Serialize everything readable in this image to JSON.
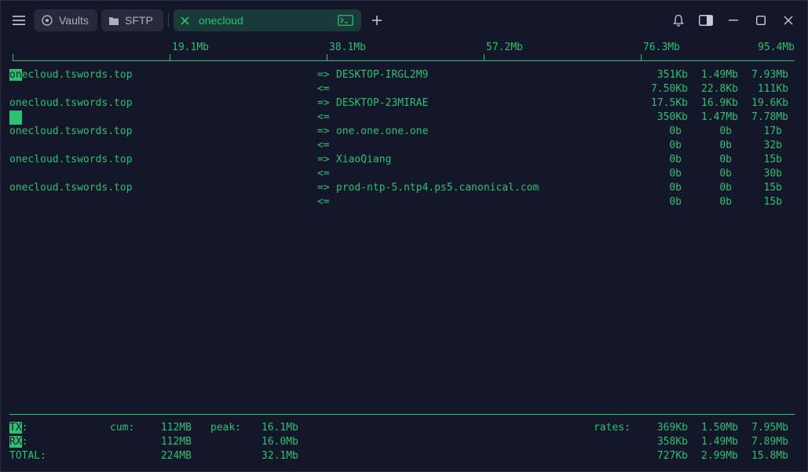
{
  "tabs": {
    "vaults": "Vaults",
    "sftp": "SFTP",
    "active": "onecloud"
  },
  "scale": [
    "19.1Mb",
    "38.1Mb",
    "57.2Mb",
    "76.3Mb",
    "95.4Mb"
  ],
  "connections": [
    {
      "host": "onecloud.tswords.top",
      "dest": "DESKTOP-IRGL2M9",
      "out": [
        "351Kb",
        "1.49Mb",
        "7.93Mb"
      ],
      "in": [
        "7.50Kb",
        "22.8Kb",
        "111Kb"
      ]
    },
    {
      "host": "onecloud.tswords.top",
      "dest": "DESKTOP-23MIRAE",
      "out": [
        "17.5Kb",
        "16.9Kb",
        "19.6Kb"
      ],
      "in": [
        "350Kb",
        "1.47Mb",
        "7.78Mb"
      ]
    },
    {
      "host": "onecloud.tswords.top",
      "dest": "one.one.one.one",
      "out": [
        "0b",
        "0b",
        "17b"
      ],
      "in": [
        "0b",
        "0b",
        "32b"
      ]
    },
    {
      "host": "onecloud.tswords.top",
      "dest": "XiaoQiang",
      "out": [
        "0b",
        "0b",
        "15b"
      ],
      "in": [
        "0b",
        "0b",
        "30b"
      ]
    },
    {
      "host": "onecloud.tswords.top",
      "dest": "prod-ntp-5.ntp4.ps5.canonical.com",
      "out": [
        "0b",
        "0b",
        "15b"
      ],
      "in": [
        "0b",
        "0b",
        "15b"
      ]
    }
  ],
  "arrows": {
    "out": "=>",
    "in": "<="
  },
  "totals": {
    "tx_label": "TX:",
    "rx_label": "RX:",
    "total_label": "TOTAL:",
    "cum_label": "cum:",
    "peak_label": "peak:",
    "rates_label": "rates:",
    "tx_cum": "112MB",
    "rx_cum": "112MB",
    "total_cum": "224MB",
    "tx_peak": "16.1Mb",
    "rx_peak": "16.0Mb",
    "total_peak": "32.1Mb",
    "tx_rates": [
      "369Kb",
      "1.50Mb",
      "7.95Mb"
    ],
    "rx_rates": [
      "358Kb",
      "1.49Mb",
      "7.89Mb"
    ],
    "total_rates": [
      "727Kb",
      "2.99Mb",
      "15.8Mb"
    ]
  },
  "colors": {
    "accent": "#2dbf72",
    "background": "#141729",
    "tab_bg": "#262a3b",
    "active_tab_bg": "#1a3a3a"
  }
}
